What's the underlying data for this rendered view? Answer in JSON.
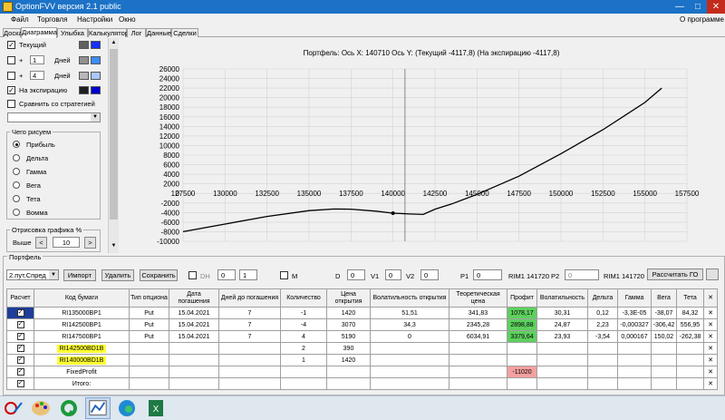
{
  "window": {
    "title": "OptionFVV версия 2.1 public",
    "minimize": "—",
    "maximize": "□",
    "close": "✕"
  },
  "menu": {
    "items": [
      "Файл",
      "Торговля",
      "Настройки",
      "Окно"
    ],
    "about": "О программе"
  },
  "tabs": [
    "Доска",
    "Диаграмма",
    "Улыбка",
    "Калькулятор",
    "Лог",
    "Данные",
    "Сделки"
  ],
  "left": {
    "row1_label": "Текущий",
    "plus": "+",
    "row2_value": "1",
    "row3_value": "4",
    "days": "Дней",
    "expiry_label": "На экспирацию",
    "compare_label": "Сравнить со стратегией",
    "what_group": "Чего рисуем",
    "radios": [
      "Прибыль",
      "Дельта",
      "Гамма",
      "Вега",
      "Тета",
      "Вомма"
    ],
    "draw_group": "Отрисовка графика %",
    "above": "Выше",
    "step_value": "10",
    "swatch_colors": [
      "#606060",
      "#1530ff",
      "#909090",
      "#3d8cff",
      "#b8b8b8",
      "#a8c8ff",
      "#202020",
      "#0000d0"
    ]
  },
  "chart_data": {
    "type": "line",
    "title": "Портфель: Ось X: 140710 Ось Y:  (Текущий -4117,8)   (На экспирацию -4117,8)",
    "x_ticks": [
      "127500",
      "130000",
      "132500",
      "135000",
      "137500",
      "140000",
      "142500",
      "145000",
      "147500",
      "150000",
      "152500",
      "155000",
      "157500"
    ],
    "y_ticks": [
      "26000",
      "24000",
      "22000",
      "20000",
      "18000",
      "16000",
      "14000",
      "12000",
      "10000",
      "8000",
      "6000",
      "4000",
      "2000",
      "0",
      "-2000",
      "-4000",
      "-6000",
      "-8000",
      "-10000"
    ],
    "xlim": [
      127500,
      157500
    ],
    "ylim": [
      -10000,
      26000
    ],
    "cursor_x": 140710,
    "marker": {
      "x": 140000,
      "y": -4117.8
    },
    "series": [
      {
        "x": [
          127500,
          130000,
          132500,
          135000,
          136500,
          137500,
          139000,
          140000,
          141000,
          141800,
          142500,
          143500,
          145000,
          147500,
          150000,
          152500,
          155000,
          156000
        ],
        "y": [
          -8000,
          -6400,
          -4800,
          -3600,
          -3250,
          -3300,
          -3700,
          -4117.8,
          -4300,
          -4400,
          -3300,
          -2200,
          -200,
          3600,
          8300,
          13300,
          19000,
          22000
        ]
      }
    ],
    "color": "#000000"
  },
  "portfolio": {
    "label": "Портфель",
    "strategy_select": "2.пут.Спред",
    "import": "Импорт",
    "delete": "Удалить",
    "save": "Сохранить",
    "dh": "DH",
    "dh_val1": "0",
    "dh_val2": "1",
    "m": "M",
    "d": "D",
    "d_val": "0",
    "v1": "V1",
    "v1_val": "0",
    "v2": "V2",
    "v2_val": "0",
    "p1": "P1",
    "p1_val": "0",
    "rim1a": "RIM1 141720",
    "p2": "P2",
    "p2_val": "0",
    "rim1b": "RIM1 141720",
    "calc_go": "Рассчитать ГО"
  },
  "table": {
    "headers": [
      "Расчет",
      "Код бумаги",
      "Тип опциона",
      "Дата погашения",
      "Дней до погашения",
      "Количество",
      "Цена открытия",
      "Волатильность открытия",
      "Теоретическая цена",
      "Профит",
      "Волатильность",
      "Дельта",
      "Гамма",
      "Вега",
      "Тета",
      "✕"
    ],
    "rows": [
      [
        "✓",
        "RI135000BP1",
        "Put",
        "15.04.2021",
        "7",
        "-1",
        "1420",
        "51,51",
        "341,83",
        "1078,17",
        "30,31",
        "0,12",
        "-3,3E-05",
        "-38,07",
        "84,32",
        "✕"
      ],
      [
        "✓",
        "RI142500BP1",
        "Put",
        "15.04.2021",
        "7",
        "-4",
        "3070",
        "34,3",
        "2345,28",
        "2898,88",
        "24,87",
        "2,23",
        "-0,000327",
        "-306,42",
        "556,95",
        "✕"
      ],
      [
        "✓",
        "RI147500BP1",
        "Put",
        "15.04.2021",
        "7",
        "4",
        "5190",
        "0",
        "6034,91",
        "3379,64",
        "23,93",
        "-3,54",
        "0,000167",
        "150,02",
        "-262,38",
        "✕"
      ],
      [
        "✓",
        "RI142500BD1B",
        "",
        "",
        "",
        "2",
        "390",
        "",
        "",
        "",
        "",
        "",
        "",
        "",
        "",
        "✕"
      ],
      [
        "✓",
        "RI140000BD1B",
        "",
        "",
        "",
        "1",
        "1420",
        "",
        "",
        "",
        "",
        "",
        "",
        "",
        "",
        "✕"
      ],
      [
        "✓",
        "FixedProfit",
        "",
        "",
        "",
        "",
        "",
        "",
        "",
        "-11020",
        "",
        "",
        "",
        "",
        "",
        "✕"
      ],
      [
        "✓",
        "Итого:",
        "",
        "",
        "",
        "",
        "",
        "",
        "",
        "",
        "",
        "",
        "",
        "",
        "",
        "✕"
      ]
    ]
  },
  "colors": {
    "profit_positive": "#5ed05e",
    "profit_negative": "#f5a0a0",
    "highlight": "#ffff33",
    "titlebar": "#1c72c6"
  },
  "taskbar_icons": [
    "paint-tool-icon",
    "palette-icon",
    "quik-icon",
    "optionfvv-icon",
    "edge-icon",
    "excel-icon"
  ]
}
